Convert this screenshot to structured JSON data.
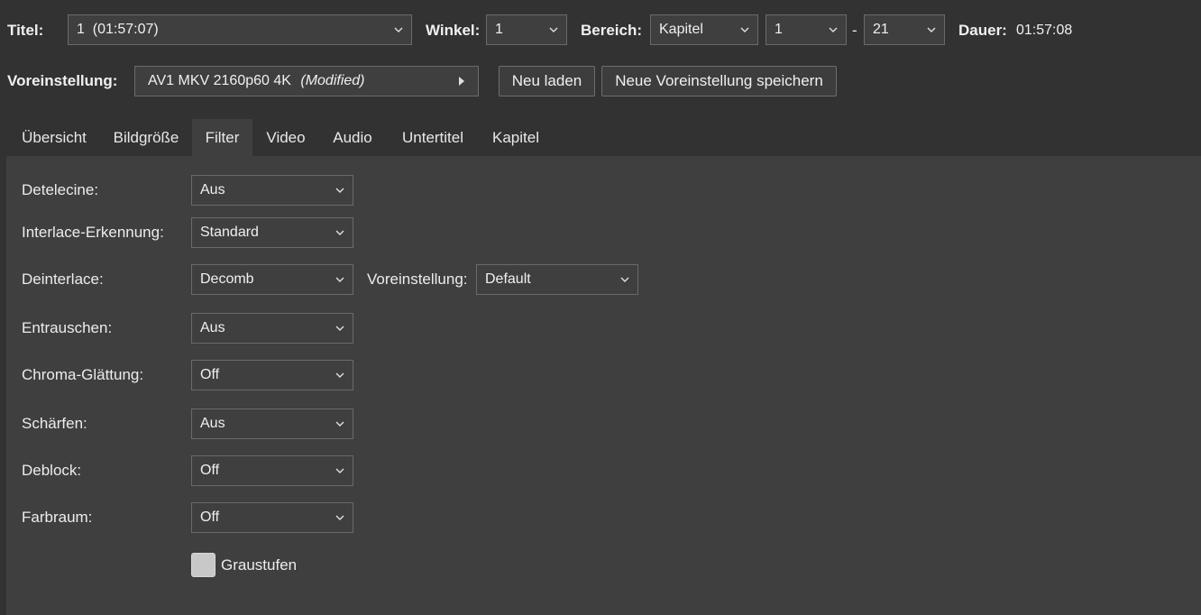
{
  "header": {
    "titel_label": "Titel:",
    "titel_value": "1  (01:57:07)",
    "winkel_label": "Winkel:",
    "winkel_value": "1",
    "bereich_label": "Bereich:",
    "bereich_mode": "Kapitel",
    "bereich_from": "1",
    "range_sep": "-",
    "bereich_to": "21",
    "dauer_label": "Dauer:",
    "dauer_value": "01:57:08"
  },
  "preset": {
    "label": "Voreinstellung:",
    "name": "AV1 MKV 2160p60 4K",
    "modified": "(Modified)",
    "reload_label": "Neu laden",
    "save_label": "Neue Voreinstellung speichern"
  },
  "tabs": [
    {
      "label": "Übersicht"
    },
    {
      "label": "Bildgröße"
    },
    {
      "label": "Filter"
    },
    {
      "label": "Video"
    },
    {
      "label": "Audio"
    },
    {
      "label": "Untertitel"
    },
    {
      "label": "Kapitel"
    }
  ],
  "active_tab": "Filter",
  "filters": {
    "detelecine": {
      "label": "Detelecine:",
      "value": "Aus"
    },
    "interlace": {
      "label": "Interlace-Erkennung:",
      "value": "Standard"
    },
    "deinterlace": {
      "label": "Deinterlace:",
      "value": "Decomb",
      "preset_label": "Voreinstellung:",
      "preset_value": "Default"
    },
    "denoise": {
      "label": "Entrauschen:",
      "value": "Aus"
    },
    "chroma": {
      "label": "Chroma-Glättung:",
      "value": "Off"
    },
    "sharpen": {
      "label": "Schärfen:",
      "value": "Aus"
    },
    "deblock": {
      "label": "Deblock:",
      "value": "Off"
    },
    "colorspace": {
      "label": "Farbraum:",
      "value": "Off"
    },
    "grayscale": {
      "label": "Graustufen",
      "checked": false
    }
  },
  "colors": {
    "background": "#323232",
    "panel": "#3f3f3f",
    "text": "#f0f0f0",
    "border": "#6a6a6a"
  }
}
